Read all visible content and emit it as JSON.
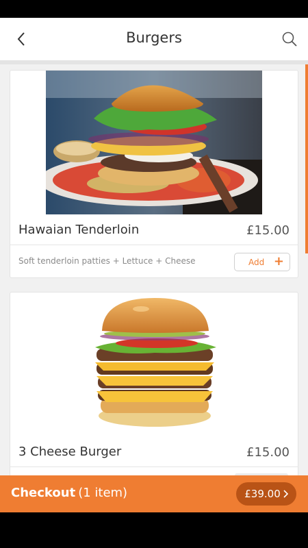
{
  "header": {
    "title": "Burgers"
  },
  "items": [
    {
      "name": "Hawaian Tenderloin",
      "price": "£15.00",
      "description": "Soft tenderloin patties + Lettuce + Cheese",
      "add_label": "Add",
      "add_icon": "+"
    },
    {
      "name": "3 Cheese Burger",
      "price": "£15.00"
    }
  ],
  "checkout": {
    "label": "Checkout",
    "count": "(1 item)",
    "total": "£39.00"
  },
  "colors": {
    "accent": "#ef7d32",
    "accent_dark": "#b95316"
  }
}
